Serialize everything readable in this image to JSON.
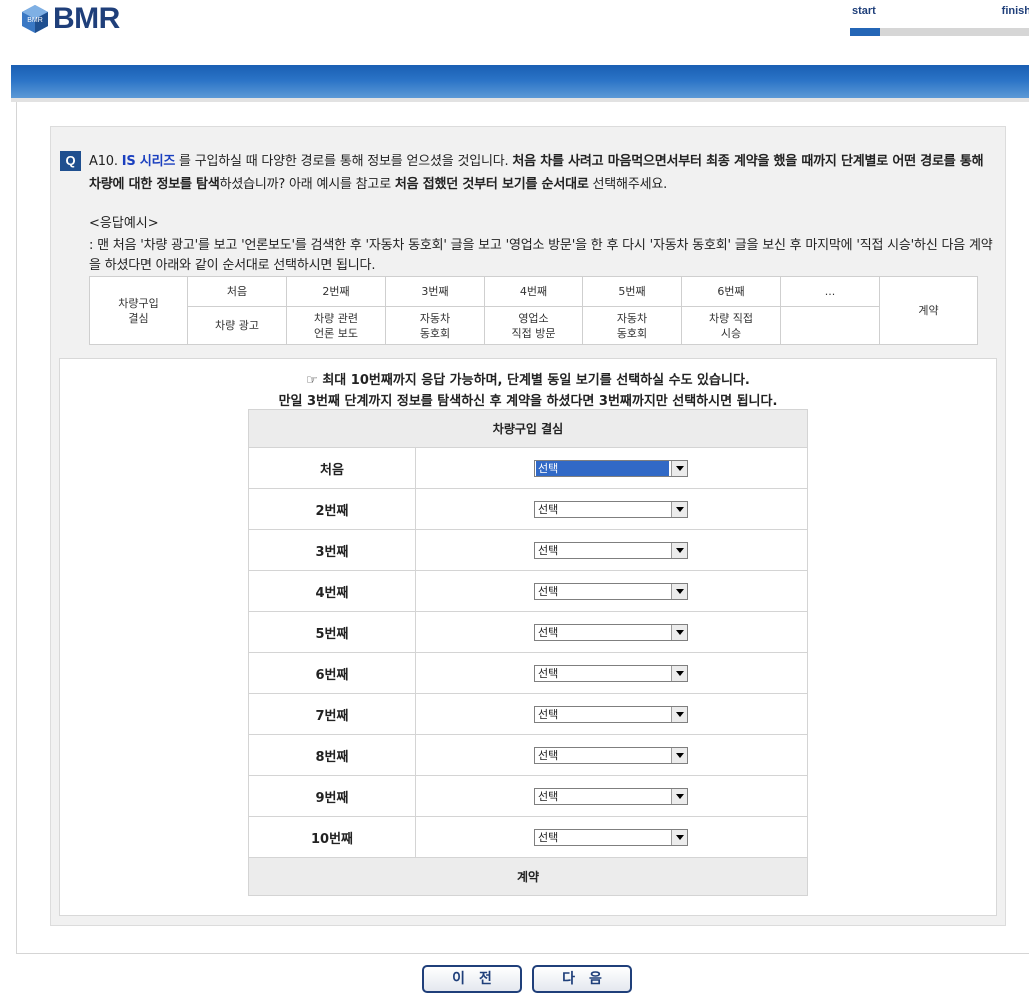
{
  "header": {
    "logo_text": "BMR",
    "logo_cube_text": "BMR",
    "progress": {
      "start_label": "start",
      "finish_label": "finish",
      "fraction": 0.17
    }
  },
  "question": {
    "badge": "Q",
    "id": "A10.",
    "brand": "IS 시리즈",
    "text_1": " 를 구입하실 때 다양한 경로를 통해 정보를 얻으셨을 것입니다. ",
    "bold_1": "처음 차를 사려고 마음먹으면서부터 최종 계약을 했을 때까지 단계별로 어떤 경로를 통해 차량에 대한 정보를 탐색",
    "text_2": "하셨습니까? 아래 예시를 참고로 ",
    "bold_2": "처음 접했던 것부터 보기를 순서대로",
    "text_3": " 선택해주세요."
  },
  "example": {
    "title": "<응답예시>",
    "description": ": 맨 처음 '차량 광고'를 보고 '언론보도'를 검색한 후 '자동차 동호회' 글을 보고 '영업소 방문'을 한 후 다시 '자동차 동호회' 글을 보신 후 마지막에 '직접 시승'하신 다음 계약을 하셨다면 아래와 같이 순서대로 선택하시면 됩니다.",
    "first_col": "차량구입\n결심",
    "last_col": "계약",
    "steps": [
      "처음",
      "2번째",
      "3번째",
      "4번째",
      "5번째",
      "6번째",
      "..."
    ],
    "values": [
      "차량 광고",
      "차량 관련\n언론 보도",
      "자동차\n동호회",
      "영업소\n직접 방문",
      "자동차\n동호회",
      "차량 직접\n시승",
      ""
    ]
  },
  "notice": {
    "line_1": "☞ 최대 10번째까지 응답 가능하며, 단계별 동일 보기를 선택하실 수도 있습니다.",
    "line_2": "만일 3번째 단계까지 정보를 탐색하신 후 계약을 하셨다면 3번째까지만 선택하시면 됩니다."
  },
  "selection": {
    "header": "차량구입 결심",
    "footer": "계약",
    "rows": [
      {
        "label": "처음",
        "value": "선택"
      },
      {
        "label": "2번째",
        "value": "선택"
      },
      {
        "label": "3번째",
        "value": "선택"
      },
      {
        "label": "4번째",
        "value": "선택"
      },
      {
        "label": "5번째",
        "value": "선택"
      },
      {
        "label": "6번째",
        "value": "선택"
      },
      {
        "label": "7번째",
        "value": "선택"
      },
      {
        "label": "8번째",
        "value": "선택"
      },
      {
        "label": "9번째",
        "value": "선택"
      },
      {
        "label": "10번째",
        "value": "선택"
      }
    ]
  },
  "nav": {
    "prev_label": "이전",
    "next_label": "다음"
  },
  "colors": {
    "brand": "#1f3f7a",
    "banner": "#2a73c6",
    "brand_highlight": "#1a3fbf",
    "selected": "#3169c6"
  }
}
